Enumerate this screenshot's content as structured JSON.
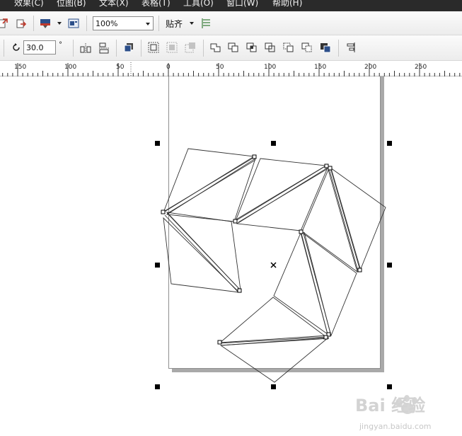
{
  "menu": {
    "items": [
      "效果(C)",
      "位图(B)",
      "文本(X)",
      "表格(T)",
      "工具(O)",
      "窗口(W)",
      "帮助(H)"
    ]
  },
  "toolbar": {
    "zoom_value": "100%",
    "snap_label": "贴齐",
    "icons_row1": [
      "import-icon",
      "export-icon",
      "application-launcher-icon",
      "welcome-screen-icon",
      "snap-options-icon"
    ]
  },
  "property_bar": {
    "rotation_angle": "30.0",
    "degree_symbol": "°",
    "icons": [
      "mirror-horizontal-icon",
      "mirror-vertical-icon",
      "to-front-icon",
      "group-icon",
      "ungroup-icon",
      "ungroup-all-icon",
      "weld-icon",
      "trim-icon",
      "intersect-icon",
      "simplify-icon",
      "front-minus-back-icon",
      "back-minus-front-icon",
      "create-boundary-icon",
      "align-distribute-icon"
    ]
  },
  "ruler": {
    "labels": [
      "150",
      "100",
      "50",
      "0",
      "50",
      "100",
      "150",
      "200",
      "250"
    ]
  },
  "canvas": {
    "object_type": "rotated triangle strips",
    "selection_handles": 8
  },
  "watermark": {
    "logo_text": "Bai 经验",
    "url": "jingyan.baidu.com"
  },
  "colors": {
    "menubar_bg": "#2a2a2a",
    "toolbar_bg": "#f0f0f0",
    "page_shadow": "#a9a9a9",
    "selection_handle": "#000000"
  }
}
